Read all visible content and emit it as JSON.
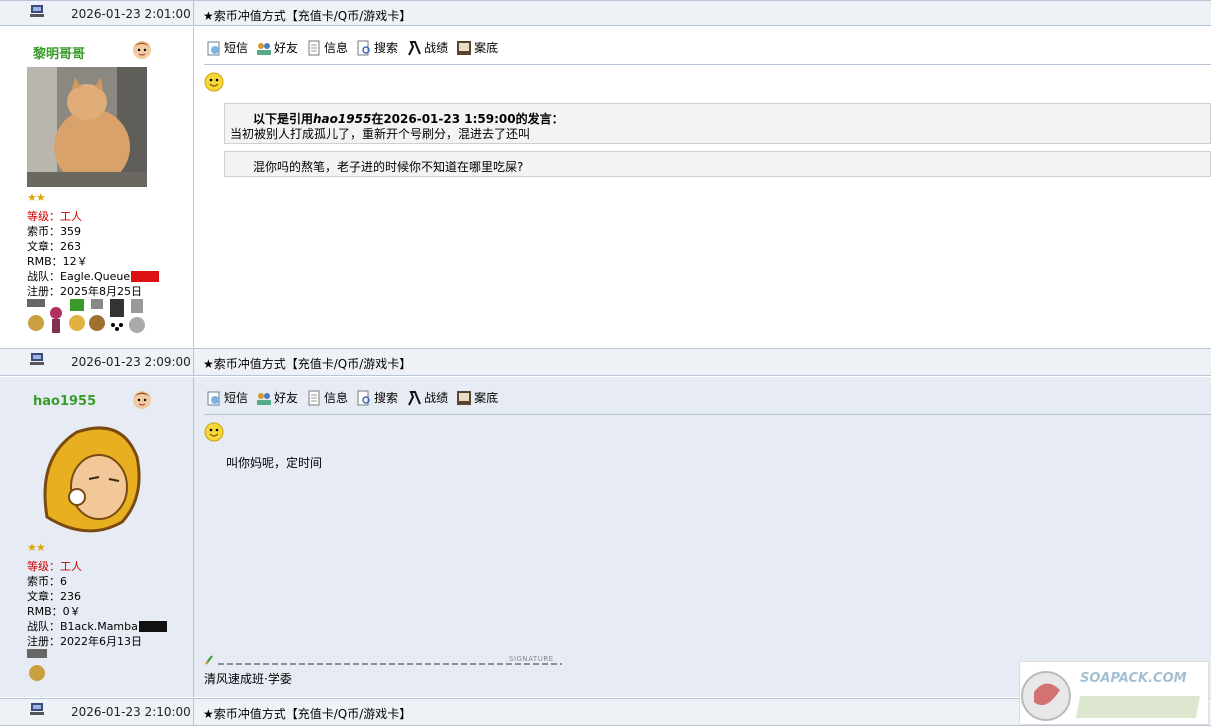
{
  "posts": [
    {
      "time": "2026-01-23 2:01:00",
      "title": "★索币冲值方式【充值卡/Q币/游戏卡】",
      "user": {
        "name": "黎明哥哥",
        "stars": "★★",
        "level_label": "等级：",
        "level": "工人",
        "coins": "索币：359",
        "posts": "文章：263",
        "rmb": "RMB：12￥",
        "team": "战队：Eagle.Queue",
        "register": "注册：2025年8月25日"
      },
      "quote_header_pre": "以下是引用",
      "quote_user": "hao1955",
      "quote_header_post": "在2026-01-23 1:59:00的发言：",
      "quote_text": "当初被别人打成孤儿了，重新开个号刷分，混进去了还叫",
      "reply": "混你吗的熬笔，老子进的时候你不知道在哪里吃屎?"
    },
    {
      "time": "2026-01-23 2:09:00",
      "title": "★索币冲值方式【充值卡/Q币/游戏卡】",
      "user": {
        "name": "hao1955",
        "stars": "★★",
        "level_label": "等级：",
        "level": "工人",
        "coins": "索币：6",
        "posts": "文章：236",
        "rmb": "RMB：0￥",
        "team": "战队：B1ack.Mamba",
        "register": "注册：2022年6月13日"
      },
      "message": "叫你妈呢，定时间",
      "sig_label": "SIGNATURE",
      "signature": "清风速成班·学委"
    },
    {
      "time": "2026-01-23 2:10:00",
      "title": "★索币冲值方式【充值卡/Q币/游戏卡】"
    }
  ],
  "toolbar": [
    "短信",
    "好友",
    "信息",
    "搜索",
    "战绩",
    "案底"
  ],
  "watermark_text": "SOAPACK.COM",
  "colors": {
    "username": "#3a9b2a",
    "level": "#cc0000",
    "border": "#b6c4d8",
    "bg_alt": "#e7ecf4"
  }
}
